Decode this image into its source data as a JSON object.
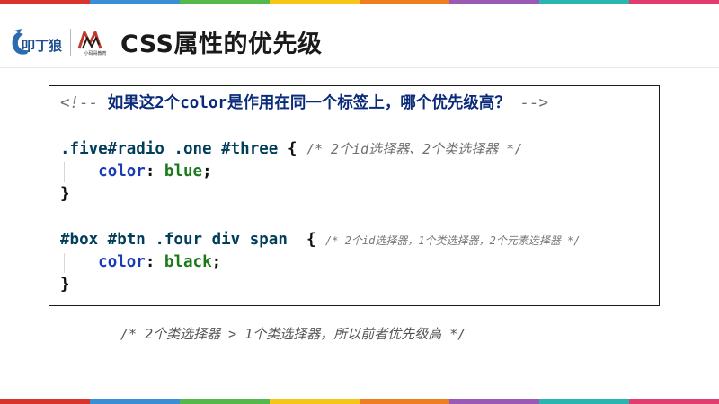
{
  "colors": {
    "strip": [
      "#d9342b",
      "#3a8ed4",
      "#55b84a",
      "#f5c518",
      "#ef7d22",
      "#9b59b6",
      "#2bb5b0",
      "#e23b6d"
    ],
    "title": "#1a1a1a",
    "comment": "#6f6f6f",
    "property": "#1a3bb8",
    "value": "#1a7a1a"
  },
  "header": {
    "logo1_name": "nail-logo",
    "logo2_name": "brand-m-logo",
    "logo2_caption": "小码哥教育",
    "title": "CSS属性的优先级"
  },
  "code": {
    "line1_prefix": "<!-- ",
    "line1_text": "如果这2个color是作用在同一个标签上，哪个优先级高？",
    "line1_suffix": " -->",
    "rule1_selector": ".five#radio .one #three",
    "rule1_open": " { ",
    "rule1_comment": "/* 2个id选择器、2个类选择器 */",
    "rule1_prop": "color",
    "rule1_colon": ": ",
    "rule1_value": "blue",
    "rule1_semi": ";",
    "rule1_close": "}",
    "rule2_selector": "#box #btn .four div span",
    "rule2_open": "  { ",
    "rule2_comment": "/* 2个id选择器，1个类选择器，2个元素选择器 */",
    "rule2_prop": "color",
    "rule2_colon": ": ",
    "rule2_value": "black",
    "rule2_semi": ";",
    "rule2_close": "}"
  },
  "conclusion": "/* 2个类选择器 > 1个类选择器，所以前者优先级高 */"
}
